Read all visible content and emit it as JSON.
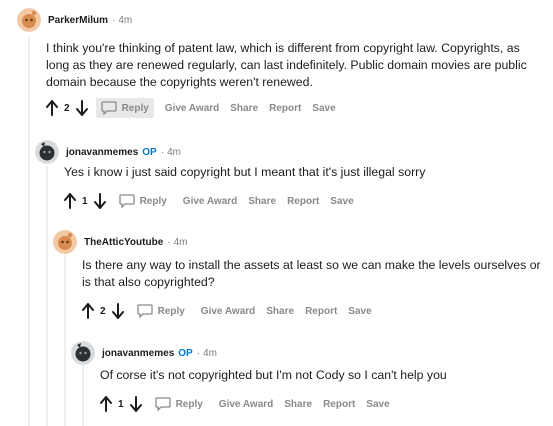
{
  "comments": [
    {
      "author": "ParkerMilum",
      "op": "",
      "sep": "·",
      "time": "4m",
      "avatar_icon": "snoo-orange-avatar",
      "lines": [
        "I think you're thinking of patent law, which is different from copyright law. Copyrights, as",
        "long as they are renewed regularly, can last indefinitely. Public domain movies are public",
        "domain because the copyrights weren't renewed."
      ],
      "score": "2",
      "actions": {
        "reply": "Reply",
        "award": "Give Award",
        "share": "Share",
        "report": "Report",
        "save": "Save"
      }
    },
    {
      "author": "jonavanmemes",
      "op": "OP",
      "sep": "·",
      "time": "4m",
      "avatar_icon": "dark-snoo-avatar",
      "lines": [
        "Yes i know i just said copyright but I meant that it's just illegal sorry"
      ],
      "score": "1",
      "actions": {
        "reply": "Reply",
        "award": "Give Award",
        "share": "Share",
        "report": "Report",
        "save": "Save"
      }
    },
    {
      "author": "TheAtticYoutube",
      "op": "",
      "sep": "·",
      "time": "4m",
      "avatar_icon": "snoo-orange-avatar",
      "lines": [
        "Is there any way to install the assets at least so we can make the levels ourselves or",
        "is that also copyrighted?"
      ],
      "score": "2",
      "actions": {
        "reply": "Reply",
        "award": "Give Award",
        "share": "Share",
        "report": "Report",
        "save": "Save"
      }
    },
    {
      "author": "jonavanmemes",
      "op": "OP",
      "sep": "·",
      "time": "4m",
      "avatar_icon": "dark-snoo-avatar",
      "lines": [
        "Of corse it's not copyrighted but I'm not Cody so I can't help you"
      ],
      "score": "1",
      "actions": {
        "reply": "Reply",
        "award": "Give Award",
        "share": "Share",
        "report": "Report",
        "save": "Save"
      }
    }
  ]
}
